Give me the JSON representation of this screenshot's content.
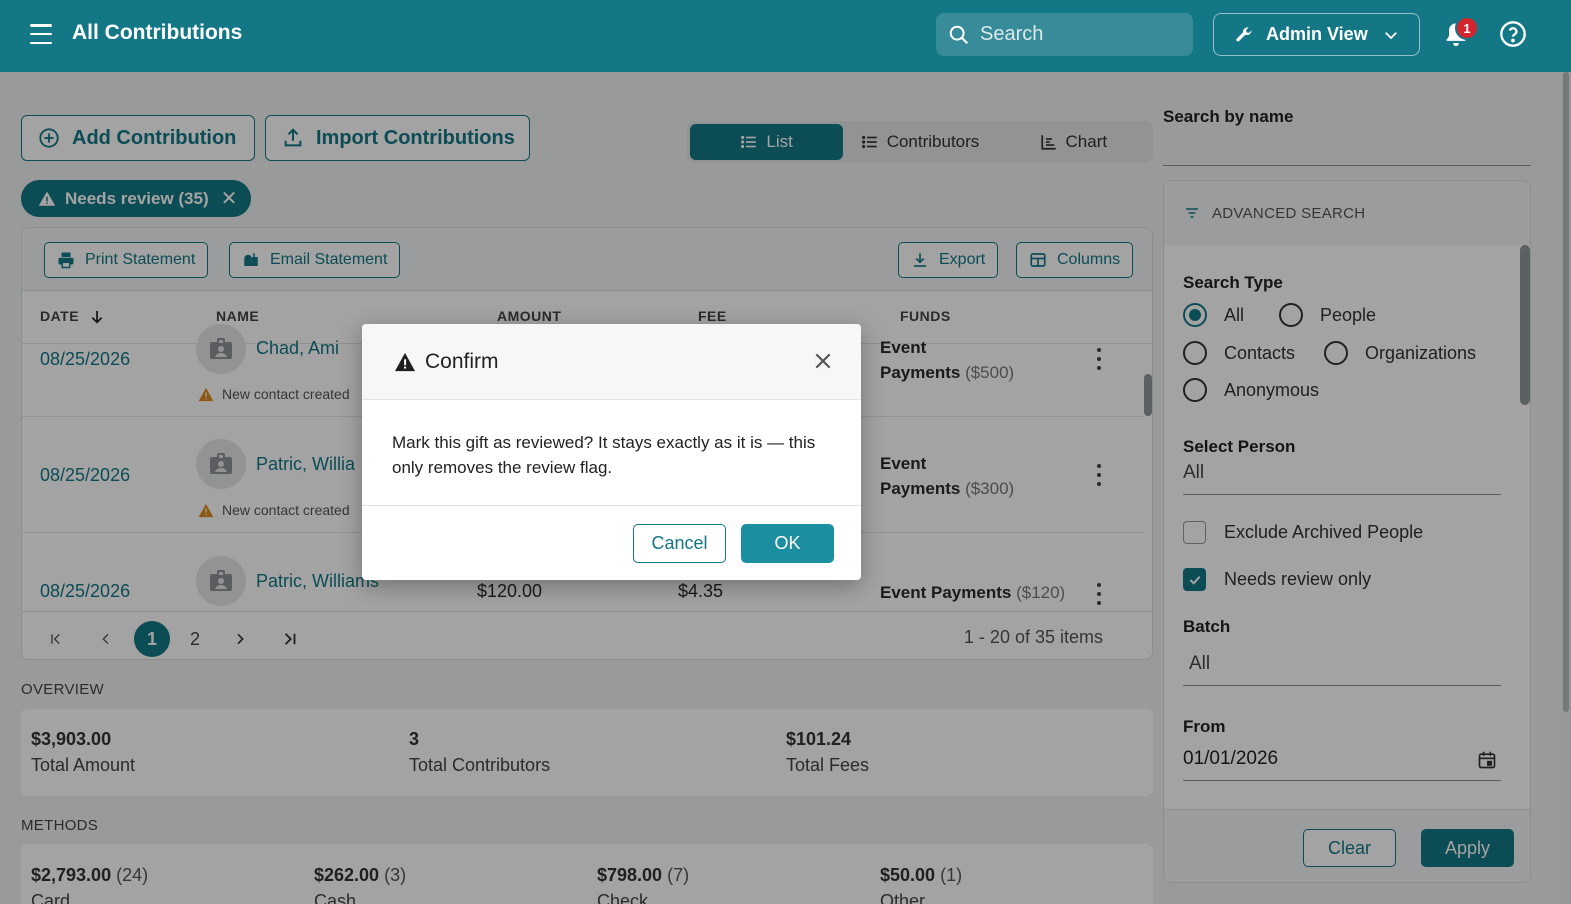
{
  "header": {
    "title": "All Contributions",
    "search_placeholder": "Search",
    "admin_view_label": "Admin View",
    "notification_count": "1"
  },
  "actions": {
    "add_contribution": "Add Contribution",
    "import_contributions": "Import Contributions"
  },
  "view_tabs": [
    {
      "label": "List",
      "active": true
    },
    {
      "label": "Contributors",
      "active": false
    },
    {
      "label": "Chart",
      "active": false
    }
  ],
  "filter_chip": {
    "label": "Needs review (35)"
  },
  "grid": {
    "toolbar": {
      "print_statement": "Print Statement",
      "email_statement": "Email Statement",
      "export": "Export",
      "columns": "Columns"
    },
    "columns": {
      "date": "DATE",
      "name": "NAME",
      "amount": "AMOUNT",
      "fee": "FEE",
      "funds": "FUNDS"
    },
    "rows": [
      {
        "date": "08/25/2026",
        "name": "Chad, Ami",
        "note": "New contact created",
        "amount": "",
        "fee": "",
        "fund_line1": "Event",
        "fund_line2": "Payments",
        "fund_amount": "($500)"
      },
      {
        "date": "08/25/2026",
        "name": "Patric, Willia",
        "note": "New contact created",
        "amount": "",
        "fee": "",
        "fund_line1": "Event",
        "fund_line2": "Payments",
        "fund_amount": "($300)"
      },
      {
        "date": "08/25/2026",
        "name": "Patric, Williams",
        "note": "",
        "amount": "$120.00",
        "fee": "$4.35",
        "fund_line1": "Event Payments",
        "fund_line2": "",
        "fund_amount": "($120)"
      }
    ],
    "pager": {
      "page1": "1",
      "page2": "2",
      "info": "1 - 20 of 35 items"
    }
  },
  "overview": {
    "label": "OVERVIEW",
    "stats": [
      {
        "value": "$3,903.00",
        "label": "Total Amount"
      },
      {
        "value": "3",
        "label": "Total Contributors"
      },
      {
        "value": "$101.24",
        "label": "Total Fees"
      }
    ]
  },
  "methods": {
    "label": "METHODS",
    "items": [
      {
        "value": "$2,793.00",
        "count": "(24)",
        "label": "Card"
      },
      {
        "value": "$262.00",
        "count": "(3)",
        "label": "Cash"
      },
      {
        "value": "$798.00",
        "count": "(7)",
        "label": "Check"
      },
      {
        "value": "$50.00",
        "count": "(1)",
        "label": "Other"
      }
    ]
  },
  "sidebar": {
    "search_by_name_label": "Search by name",
    "advanced_search_label": "ADVANCED SEARCH",
    "search_type_label": "Search Type",
    "search_types": [
      "All",
      "People",
      "Contacts",
      "Organizations",
      "Anonymous"
    ],
    "select_person_label": "Select Person",
    "select_person_value": "All",
    "exclude_archived_label": "Exclude Archived People",
    "needs_review_label": "Needs review only",
    "batch_label": "Batch",
    "batch_value": "All",
    "from_label": "From",
    "from_value": "01/01/2026",
    "clear_label": "Clear",
    "apply_label": "Apply"
  },
  "modal": {
    "title": "Confirm",
    "message": "Mark this gift as reviewed? It stays exactly as it is — this only removes the review flag.",
    "cancel_label": "Cancel",
    "ok_label": "OK"
  },
  "colors": {
    "brand": "#137786",
    "badge": "#d1242f",
    "warning": "#d98c1c"
  }
}
